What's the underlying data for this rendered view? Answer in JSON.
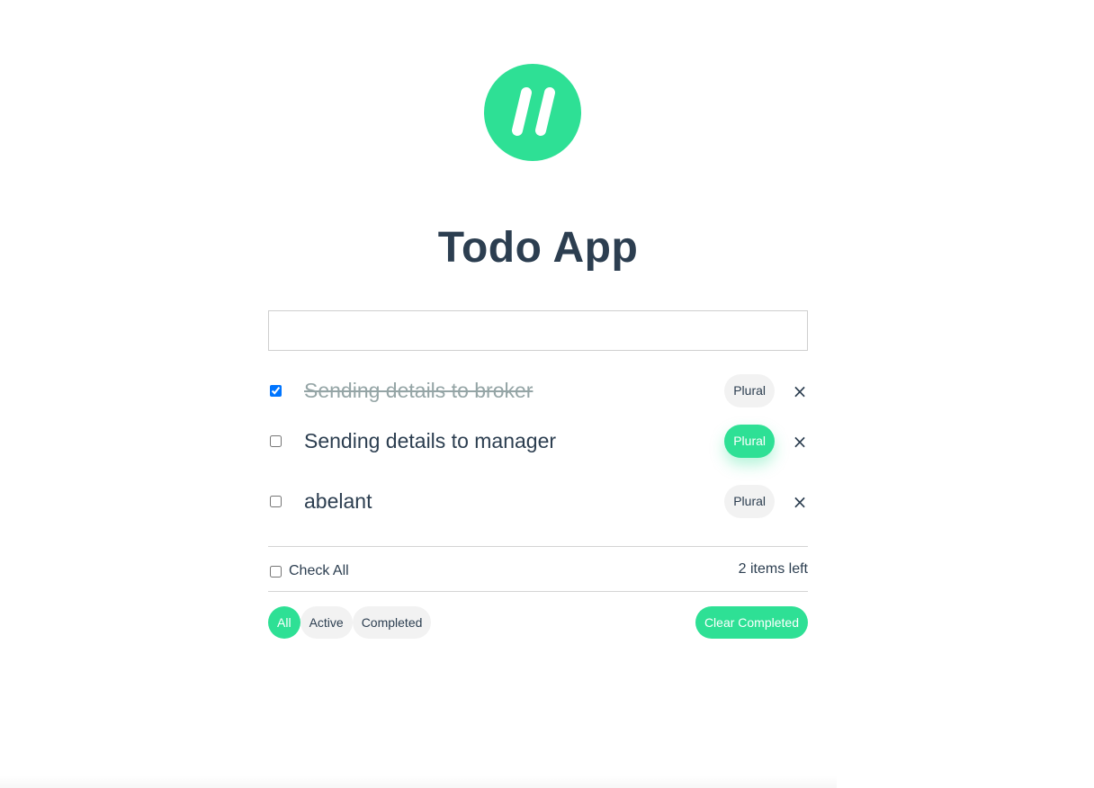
{
  "app": {
    "title": "Todo App",
    "logo_icon": "double-slash-logo-icon",
    "accent_color": "#2ee095",
    "text_color": "#2c3e50"
  },
  "new_todo": {
    "value": "",
    "placeholder": ""
  },
  "todos": [
    {
      "text": "Sending details to broker",
      "completed": true,
      "plural_label": "Plural",
      "plural_active": false,
      "remove_label": "×"
    },
    {
      "text": "Sending details to manager",
      "completed": false,
      "plural_label": "Plural",
      "plural_active": true,
      "remove_label": "×"
    },
    {
      "text": "abelant",
      "completed": false,
      "plural_label": "Plural",
      "plural_active": false,
      "remove_label": "×"
    }
  ],
  "footer": {
    "check_all_label": "Check All",
    "check_all_checked": false,
    "items_left": "2 items left"
  },
  "filters": [
    {
      "label": "All",
      "selected": true
    },
    {
      "label": "Active",
      "selected": false
    },
    {
      "label": "Completed",
      "selected": false
    }
  ],
  "clear_completed_label": "Clear Completed"
}
